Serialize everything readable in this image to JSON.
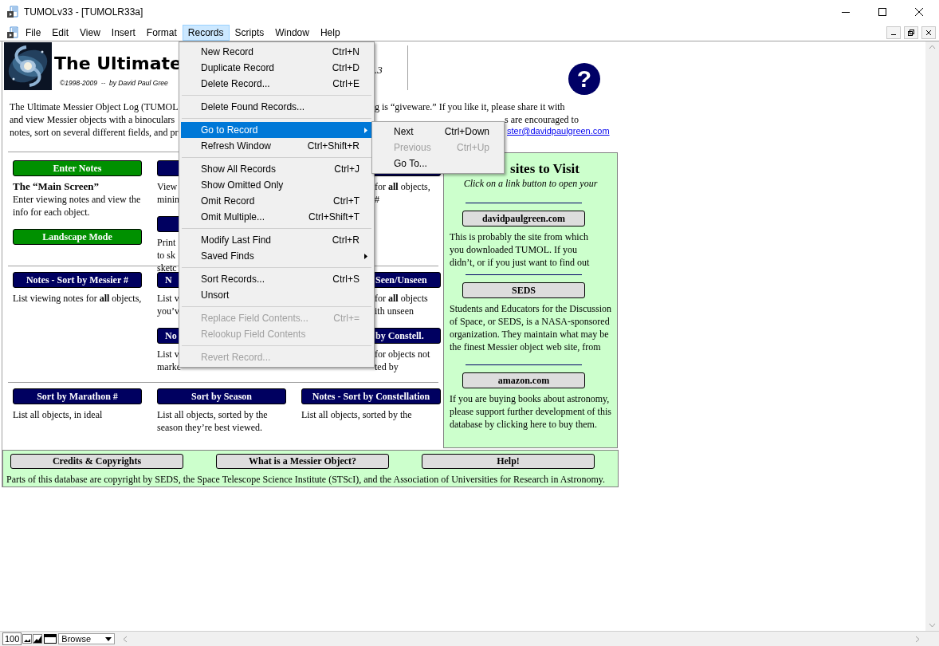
{
  "window": {
    "title": "TUMOLv33 - [TUMOLR33a]"
  },
  "menu_bar": [
    {
      "label": "File",
      "selected": false
    },
    {
      "label": "Edit",
      "selected": false
    },
    {
      "label": "View",
      "selected": false
    },
    {
      "label": "Insert",
      "selected": false
    },
    {
      "label": "Format",
      "selected": false
    },
    {
      "label": "Records",
      "selected": true
    },
    {
      "label": "Scripts",
      "selected": false
    },
    {
      "label": "Window",
      "selected": false
    },
    {
      "label": "Help",
      "selected": false
    }
  ],
  "records_menu": [
    {
      "kind": "item",
      "label": "New Record",
      "shortcut": "Ctrl+N",
      "selected": false,
      "disabled": false
    },
    {
      "kind": "item",
      "label": "Duplicate Record",
      "shortcut": "Ctrl+D",
      "selected": false,
      "disabled": false
    },
    {
      "kind": "item",
      "label": "Delete Record...",
      "shortcut": "Ctrl+E",
      "selected": false,
      "disabled": false
    },
    {
      "kind": "separator"
    },
    {
      "kind": "item",
      "label": "Delete Found Records...",
      "selected": false,
      "disabled": false
    },
    {
      "kind": "separator"
    },
    {
      "kind": "submenu",
      "label": "Go to Record",
      "selected": true,
      "disabled": false
    },
    {
      "kind": "item",
      "label": "Refresh Window",
      "shortcut": "Ctrl+Shift+R",
      "selected": false,
      "disabled": false
    },
    {
      "kind": "separator"
    },
    {
      "kind": "item",
      "label": "Show All Records",
      "shortcut": "Ctrl+J",
      "selected": false,
      "disabled": false
    },
    {
      "kind": "item",
      "label": "Show Omitted Only",
      "selected": false,
      "disabled": false
    },
    {
      "kind": "item",
      "label": "Omit Record",
      "shortcut": "Ctrl+T",
      "selected": false,
      "disabled": false
    },
    {
      "kind": "item",
      "label": "Omit Multiple...",
      "shortcut": "Ctrl+Shift+T",
      "selected": false,
      "disabled": false
    },
    {
      "kind": "separator"
    },
    {
      "kind": "item",
      "label": "Modify Last Find",
      "shortcut": "Ctrl+R",
      "selected": false,
      "disabled": false
    },
    {
      "kind": "submenu",
      "label": "Saved Finds",
      "selected": false,
      "disabled": false
    },
    {
      "kind": "separator"
    },
    {
      "kind": "item",
      "label": "Sort Records...",
      "shortcut": "Ctrl+S",
      "selected": false,
      "disabled": false
    },
    {
      "kind": "item",
      "label": "Unsort",
      "selected": false,
      "disabled": false
    },
    {
      "kind": "separator"
    },
    {
      "kind": "item",
      "label": "Replace Field Contents...",
      "shortcut": "Ctrl+=",
      "selected": false,
      "disabled": true
    },
    {
      "kind": "item",
      "label": "Relookup Field Contents",
      "selected": false,
      "disabled": true
    },
    {
      "kind": "separator"
    },
    {
      "kind": "item",
      "label": "Revert Record...",
      "selected": false,
      "disabled": true
    }
  ],
  "go_to_submenu": [
    {
      "kind": "item",
      "label": "Next",
      "shortcut": "Ctrl+Down",
      "selected": false,
      "disabled": false
    },
    {
      "kind": "item",
      "label": "Previous",
      "shortcut": "Ctrl+Up",
      "selected": false,
      "disabled": true
    },
    {
      "kind": "item",
      "label": "Go To...",
      "selected": false,
      "disabled": false
    }
  ],
  "header": {
    "title": "The Ultimate",
    "credit": "©1998-2009  --  by David Paul Gree",
    "version": ".3",
    "help_icon": "?"
  },
  "intro": [
    {
      "left": "The Ultimate Messier Object Log (TUMOL",
      "right": "g is “giveware.” If you like it, please share it with"
    },
    {
      "left": "and view Messier objects with a binoculars",
      "right": "s are encouraged to"
    },
    {
      "left": "notes, sort on several different fields, and pr",
      "link": "ster@davidpaulgreen.com"
    }
  ],
  "sections": [
    {
      "cells": [
        [
          {
            "kind": "button",
            "label": "Enter Notes"
          },
          {
            "kind": "heading",
            "text": "The “Main Screen”"
          },
          {
            "kind": "text",
            "lines": [
              "Enter viewing notes and view the",
              "info for each object."
            ]
          },
          {
            "kind": "button",
            "label": "Landscape Mode"
          }
        ],
        [
          {
            "kind": "button"
          },
          {
            "kind": "text",
            "lines": [
              "View",
              "minin"
            ]
          },
          {
            "kind": "button"
          },
          {
            "kind": "text",
            "lines": [
              "Print",
              "to sk",
              "sketc"
            ]
          }
        ],
        [
          {
            "kind": "button"
          },
          {
            "kind": "text",
            "lines": [
              "for **all** objects,",
              "#"
            ]
          }
        ]
      ]
    },
    {
      "cells": [
        [
          {
            "kind": "button",
            "label": "Notes - Sort by Messier #"
          },
          {
            "kind": "text",
            "lines": [
              "List viewing notes for **all** objects,"
            ]
          }
        ],
        [
          {
            "kind": "button",
            "label": "N"
          },
          {
            "kind": "text",
            "lines": [
              "List v",
              "you’v"
            ]
          },
          {
            "kind": "button",
            "label": "No"
          },
          {
            "kind": "text",
            "lines": [
              "List v",
              "marke"
            ]
          }
        ],
        [
          {
            "kind": "button",
            "label": "Seen/Unseen"
          },
          {
            "kind": "text",
            "lines": [
              "for **all** objects",
              "ith unseen"
            ]
          },
          {
            "kind": "button",
            "label": "by Constell."
          },
          {
            "kind": "text",
            "lines": [
              "for objects not",
              "ted by"
            ]
          }
        ]
      ]
    },
    {
      "cells": [
        [
          {
            "kind": "button",
            "label": "Sort by Marathon #"
          },
          {
            "kind": "text",
            "lines": [
              "List all objects, in ideal"
            ]
          }
        ],
        [
          {
            "kind": "button",
            "label": "Sort by Season"
          },
          {
            "kind": "text",
            "lines": [
              "List all objects, sorted by the",
              "season they’re best viewed."
            ]
          }
        ],
        [
          {
            "kind": "button",
            "label": "Notes - Sort by Constellation"
          },
          {
            "kind": "text",
            "lines": [
              "List all objects, sorted by the"
            ]
          }
        ]
      ]
    }
  ],
  "web_sites": {
    "title": "sites to Visit",
    "subtitle": "Click on a link button to open your",
    "sites": [
      {
        "label": "davidpaulgreen.com",
        "lines": [
          "This is probably the site from which",
          "you downloaded TUMOL. If you",
          "didn’t, or if you just want to find out"
        ]
      },
      {
        "label": "SEDS",
        "lines": [
          "Students and Educators for the Discussion",
          "of Space, or SEDS, is a NASA-sponsored",
          "organization. They maintain what may be",
          "the finest Messier object web site, from"
        ]
      },
      {
        "label": "amazon.com",
        "lines": [
          "If you are buying books about astronomy,",
          "please support further development of this",
          "database by clicking here to buy them."
        ]
      }
    ]
  },
  "footer": {
    "buttons": [
      "Credits & Copyrights",
      "What is a Messier Object?",
      "Help!"
    ],
    "note": "Parts of this database are copyright by SEDS, the Space Telescope Science Institute (STScI), and the Association of Universities for Research in Astronomy."
  },
  "status_bar": {
    "zoom": "100",
    "mode": "Browse"
  }
}
